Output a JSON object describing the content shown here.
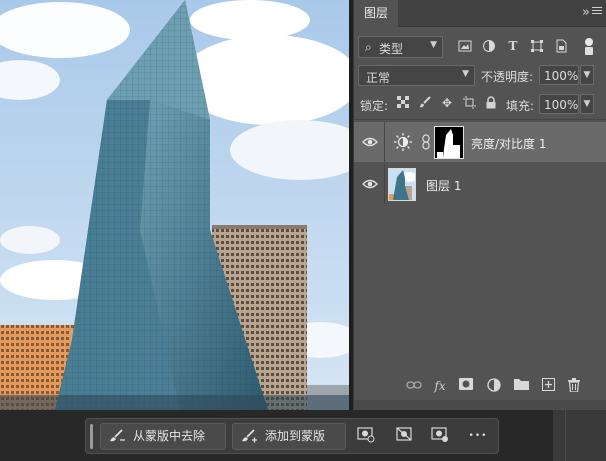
{
  "layers_panel": {
    "tab_title": "图层",
    "collapse_glyph": "»",
    "filter": {
      "kind_label": "类型",
      "search_icon": "search-icon",
      "dropdown_glyph": "⌄"
    },
    "filter_icons": [
      "image-filter-icon",
      "adjustment-filter-icon",
      "type-filter-icon",
      "shape-filter-icon",
      "smart-object-filter-icon"
    ],
    "blend_mode": "正常",
    "opacity_label": "不透明度:",
    "opacity_value": "100%",
    "lock_label": "锁定:",
    "lock_icons": [
      "lock-transparent-icon",
      "lock-paint-icon",
      "lock-position-icon",
      "lock-artboard-icon",
      "lock-all-icon"
    ],
    "fill_label": "填充:",
    "fill_value": "100%",
    "layers": [
      {
        "name": "亮度/对比度 1",
        "type": "adjustment",
        "visible": true,
        "selected": true
      },
      {
        "name": "图层 1",
        "type": "pixel",
        "visible": true,
        "selected": false
      }
    ],
    "footer_icons": [
      "link-layers-icon",
      "fx-icon",
      "add-mask-icon",
      "new-adjustment-icon",
      "new-group-icon",
      "new-layer-icon",
      "delete-layer-icon"
    ],
    "footer_fx": "fx"
  },
  "taskbar": {
    "subtract_label": "从蒙版中去除",
    "add_label": "添加到蒙版",
    "more_glyph": "•••"
  },
  "colors": {
    "panel_bg": "#535353",
    "selected_layer": "#6a6a6a",
    "app_bg": "#282828"
  }
}
